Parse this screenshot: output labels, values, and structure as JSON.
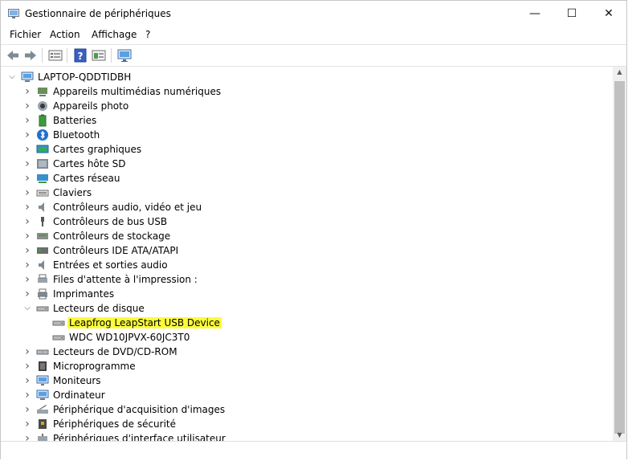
{
  "window": {
    "title": "Gestionnaire de périphériques"
  },
  "window_controls": {
    "minimize": "—",
    "maximize": "☐",
    "close": "✕"
  },
  "menu": [
    "Fichier",
    "Action",
    "Affichage",
    "?"
  ],
  "toolbar": {
    "icons": [
      "back-arrow-icon",
      "forward-arrow-icon",
      "properties-icon",
      "help-icon",
      "view-icon",
      "monitor-scan-icon"
    ]
  },
  "tree": {
    "root": "LAPTOP-QDDTIDBH",
    "items": [
      {
        "label": "Appareils multimédias numériques",
        "icon": "multimedia-icon",
        "expanded": false,
        "level": 1
      },
      {
        "label": "Appareils photo",
        "icon": "camera-icon",
        "expanded": false,
        "level": 1
      },
      {
        "label": "Batteries",
        "icon": "battery-icon",
        "expanded": false,
        "level": 1
      },
      {
        "label": "Bluetooth",
        "icon": "bluetooth-icon",
        "expanded": false,
        "level": 1
      },
      {
        "label": "Cartes graphiques",
        "icon": "display-adapter-icon",
        "expanded": false,
        "level": 1
      },
      {
        "label": "Cartes hôte SD",
        "icon": "sd-host-icon",
        "expanded": false,
        "level": 1
      },
      {
        "label": "Cartes réseau",
        "icon": "network-icon",
        "expanded": false,
        "level": 1
      },
      {
        "label": "Claviers",
        "icon": "keyboard-icon",
        "expanded": false,
        "level": 1
      },
      {
        "label": "Contrôleurs audio, vidéo et jeu",
        "icon": "speaker-icon",
        "expanded": false,
        "level": 1
      },
      {
        "label": "Contrôleurs de bus USB",
        "icon": "usb-icon",
        "expanded": false,
        "level": 1
      },
      {
        "label": "Contrôleurs de stockage",
        "icon": "storage-controller-icon",
        "expanded": false,
        "level": 1
      },
      {
        "label": "Contrôleurs IDE ATA/ATAPI",
        "icon": "ide-icon",
        "expanded": false,
        "level": 1
      },
      {
        "label": "Entrées et sorties audio",
        "icon": "speaker-icon",
        "expanded": false,
        "level": 1
      },
      {
        "label": "Files d'attente à l'impression :",
        "icon": "print-queue-icon",
        "expanded": false,
        "level": 1
      },
      {
        "label": "Imprimantes",
        "icon": "printer-icon",
        "expanded": false,
        "level": 1
      },
      {
        "label": "Lecteurs de disque",
        "icon": "disk-drive-icon",
        "expanded": true,
        "level": 1
      },
      {
        "label": "Leapfrog LeapStart USB Device",
        "icon": "disk-drive-icon",
        "level": 2,
        "highlight": true
      },
      {
        "label": "WDC WD10JPVX-60JC3T0",
        "icon": "disk-drive-icon",
        "level": 2
      },
      {
        "label": "Lecteurs de DVD/CD-ROM",
        "icon": "dvd-icon",
        "expanded": false,
        "level": 1
      },
      {
        "label": "Microprogramme",
        "icon": "firmware-icon",
        "expanded": false,
        "level": 1
      },
      {
        "label": "Moniteurs",
        "icon": "monitor-icon",
        "expanded": false,
        "level": 1
      },
      {
        "label": "Ordinateur",
        "icon": "computer-icon",
        "expanded": false,
        "level": 1
      },
      {
        "label": "Périphérique d'acquisition d'images",
        "icon": "scanner-icon",
        "expanded": false,
        "level": 1
      },
      {
        "label": "Périphériques de sécurité",
        "icon": "security-icon",
        "expanded": false,
        "level": 1
      },
      {
        "label": "Périphériques d'interface utilisateur",
        "icon": "hid-icon",
        "expanded": false,
        "level": 1
      }
    ]
  },
  "colors": {
    "highlight": "#fbfb3c",
    "accent": "#1f6fd1"
  }
}
